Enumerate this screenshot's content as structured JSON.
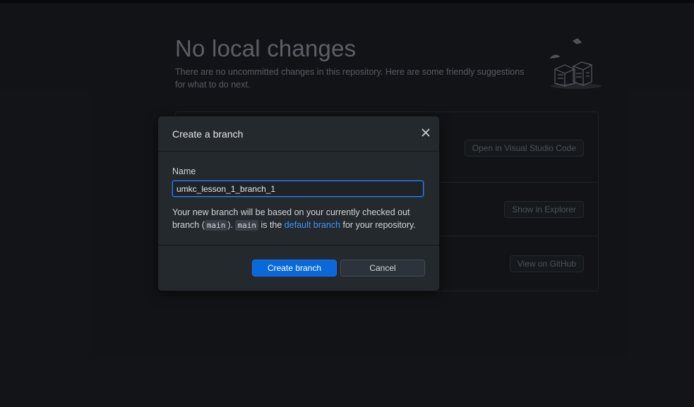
{
  "background": {
    "title": "No local changes",
    "description": "There are no uncommitted changes in this repository. Here are some friendly suggestions for what to do next.",
    "actions": [
      {
        "label": "Open in Visual Studio Code"
      },
      {
        "label": "Show in Explorer"
      },
      {
        "label": "View on GitHub"
      }
    ]
  },
  "dialog": {
    "title": "Create a branch",
    "name_label": "Name",
    "name_value": "umkc_lesson_1_branch_1",
    "desc_part1": "Your new branch will be based on your currently checked out branch (",
    "branch_code": "main",
    "desc_part2": "). ",
    "branch_code2": "main",
    "desc_part3": " is the ",
    "default_branch_link": "default branch",
    "desc_part4": " for your repository.",
    "create_button": "Create branch",
    "cancel_button": "Cancel"
  },
  "colors": {
    "accent": "#0969da",
    "link": "#4493f8",
    "dialog_bg": "#24292e",
    "page_bg": "#16181c"
  }
}
